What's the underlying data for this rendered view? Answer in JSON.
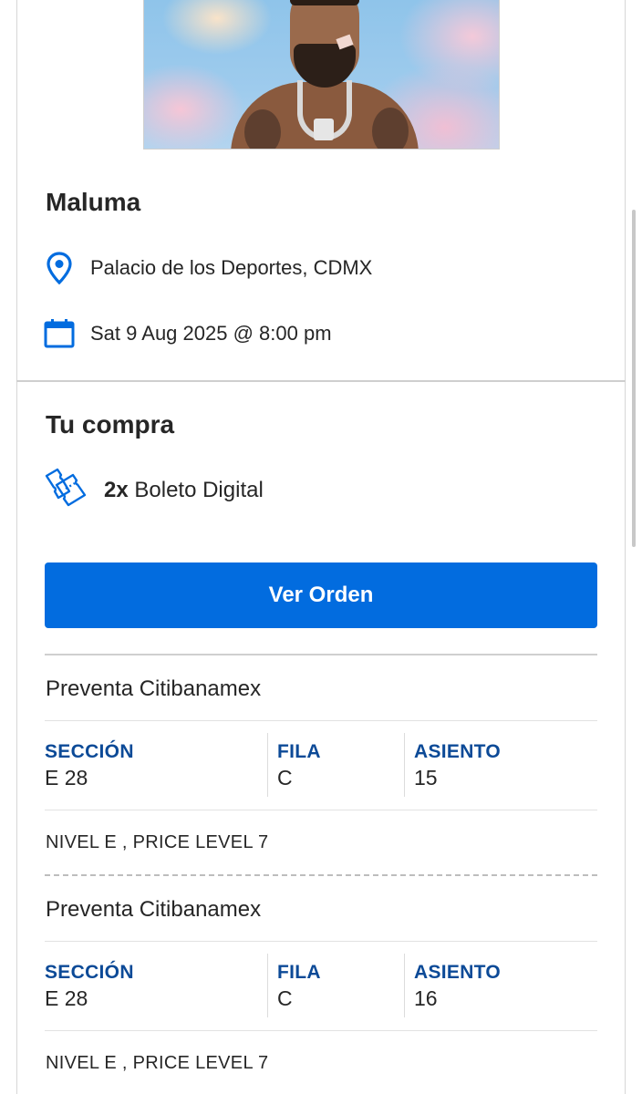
{
  "event": {
    "artist": "Maluma",
    "venue": "Palacio de los Deportes, CDMX",
    "datetime": "Sat 9 Aug 2025 @ 8:00 pm"
  },
  "purchase": {
    "title": "Tu compra",
    "quantity": "2x",
    "ticket_type": "Boleto Digital",
    "button_label": "Ver Orden"
  },
  "tickets": [
    {
      "presale": "Preventa Citibanamex",
      "section_label": "SECCIÓN",
      "section": "E 28",
      "row_label": "FILA",
      "row": "C",
      "seat_label": "ASIENTO",
      "seat": "15",
      "level": "NIVEL E , PRICE LEVEL 7"
    },
    {
      "presale": "Preventa Citibanamex",
      "section_label": "SECCIÓN",
      "section": "E 28",
      "row_label": "FILA",
      "row": "C",
      "seat_label": "ASIENTO",
      "seat": "16",
      "level": "NIVEL E , PRICE LEVEL 7"
    }
  ],
  "icons": {
    "location": "location-pin-icon",
    "calendar": "calendar-icon",
    "tickets": "tickets-icon"
  },
  "colors": {
    "accent": "#026cdf",
    "label_blue": "#0c4a97",
    "text": "#262626"
  }
}
